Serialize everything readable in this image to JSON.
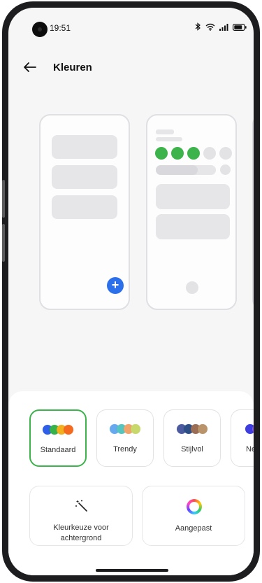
{
  "status_bar": {
    "time": "19:51"
  },
  "header": {
    "title": "Kleuren"
  },
  "theme_options": [
    {
      "label": "Standaard",
      "selected": true,
      "swatches": [
        "#2f5ee8",
        "#36b24a",
        "#f2b01e",
        "#f46a1f"
      ]
    },
    {
      "label": "Trendy",
      "selected": false,
      "swatches": [
        "#66a9ef",
        "#56c5c0",
        "#f0a36a",
        "#c9d86a"
      ]
    },
    {
      "label": "Stijlvol",
      "selected": false,
      "swatches": [
        "#4c5aa0",
        "#2d4f86",
        "#9a6d54",
        "#b9946a"
      ]
    },
    {
      "label": "Ne",
      "selected": false,
      "swatches": [
        "#3d3de0",
        "#8f5ae8"
      ]
    }
  ],
  "actions": {
    "wallpaper_label_line1": "Kleurkeuze voor",
    "wallpaper_label_line2": "achtergrond",
    "custom_label": "Aangepast"
  },
  "colors": {
    "accent_green": "#3db34b",
    "fab_blue": "#2b6fea"
  }
}
